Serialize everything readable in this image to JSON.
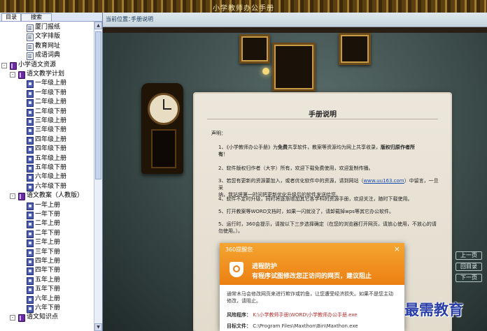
{
  "window": {
    "title": "小学教师办公手册"
  },
  "left_tabs": [
    {
      "label": "目录"
    },
    {
      "label": "搜索"
    }
  ],
  "tree": [
    {
      "label": "厦门报纸",
      "indent": 2,
      "icon": "document-icon",
      "expander": ""
    },
    {
      "label": "文字排版",
      "indent": 2,
      "icon": "document-icon",
      "expander": ""
    },
    {
      "label": "教育网址",
      "indent": 2,
      "icon": "document-icon",
      "expander": ""
    },
    {
      "label": "成语词典",
      "indent": 2,
      "icon": "document-icon",
      "expander": ""
    },
    {
      "label": "小学语文资源",
      "indent": 0,
      "icon": "book-icon",
      "expander": "-"
    },
    {
      "label": "语文教学计划",
      "indent": 1,
      "icon": "book-icon",
      "expander": "-"
    },
    {
      "label": "一年级上册",
      "indent": 2,
      "icon": "page-icon",
      "expander": ""
    },
    {
      "label": "一年级下册",
      "indent": 2,
      "icon": "page-icon",
      "expander": ""
    },
    {
      "label": "二年级上册",
      "indent": 2,
      "icon": "page-icon",
      "expander": ""
    },
    {
      "label": "二年级下册",
      "indent": 2,
      "icon": "page-icon",
      "expander": ""
    },
    {
      "label": "三年级上册",
      "indent": 2,
      "icon": "page-icon",
      "expander": ""
    },
    {
      "label": "三年级下册",
      "indent": 2,
      "icon": "page-icon",
      "expander": ""
    },
    {
      "label": "四年级上册",
      "indent": 2,
      "icon": "page-icon",
      "expander": ""
    },
    {
      "label": "四年级下册",
      "indent": 2,
      "icon": "page-icon",
      "expander": ""
    },
    {
      "label": "五年级上册",
      "indent": 2,
      "icon": "page-icon",
      "expander": ""
    },
    {
      "label": "五年级下册",
      "indent": 2,
      "icon": "page-icon",
      "expander": ""
    },
    {
      "label": "六年级上册",
      "indent": 2,
      "icon": "page-icon",
      "expander": ""
    },
    {
      "label": "六年级下册",
      "indent": 2,
      "icon": "page-icon",
      "expander": ""
    },
    {
      "label": "语文教案（人教版）",
      "indent": 1,
      "icon": "book-icon",
      "expander": "-"
    },
    {
      "label": "一年上册",
      "indent": 2,
      "icon": "page-icon",
      "expander": ""
    },
    {
      "label": "一年下册",
      "indent": 2,
      "icon": "page-icon",
      "expander": ""
    },
    {
      "label": "二年上册",
      "indent": 2,
      "icon": "page-icon",
      "expander": ""
    },
    {
      "label": "二年下册",
      "indent": 2,
      "icon": "page-icon",
      "expander": ""
    },
    {
      "label": "三年上册",
      "indent": 2,
      "icon": "page-icon",
      "expander": ""
    },
    {
      "label": "三年下册",
      "indent": 2,
      "icon": "page-icon",
      "expander": ""
    },
    {
      "label": "四年上册",
      "indent": 2,
      "icon": "page-icon",
      "expander": ""
    },
    {
      "label": "四年下册",
      "indent": 2,
      "icon": "page-icon",
      "expander": ""
    },
    {
      "label": "五年上册",
      "indent": 2,
      "icon": "page-icon",
      "expander": ""
    },
    {
      "label": "五年下册",
      "indent": 2,
      "icon": "page-icon",
      "expander": ""
    },
    {
      "label": "六年上册",
      "indent": 2,
      "icon": "page-icon",
      "expander": ""
    },
    {
      "label": "六年下册",
      "indent": 2,
      "icon": "page-icon",
      "expander": ""
    },
    {
      "label": "语文知识点",
      "indent": 1,
      "icon": "book-icon",
      "expander": "-"
    }
  ],
  "breadcrumb": {
    "prefix": "当前位置：",
    "current": "手册说明"
  },
  "document": {
    "title": "手册说明",
    "intro": "声明：",
    "p1_a": "1、《小学教师办公手册》为",
    "p1_bold1": "免费",
    "p1_b": "共享软件，教案等资源均为网上共享收录，",
    "p1_bold2": "版权归原作者所",
    "p1_bold3": "有",
    "p1_c": "！",
    "p2": "2、软件版权归作者（大宇）所有，欢迎下载免费使用，欢迎复制传播。",
    "p3_a": "3、若您有更新的资源要加入，或者优化软件中的资源，请到网站（",
    "p3_link": "www.uu163.com",
    "p3_b": "）中留言，一旦采",
    "p3_c": "纳，我站将第一时间把更新优化升级后的软件发送给您。",
    "p4": "4、软件不定时升级，同时将逐渐增加其它各学科的资源手册，欢迎关注，随时下载使用。",
    "p5": "5、打开教案等WORD文档时，如果一闪就没了，请卸载掉wps等其它办公软件。",
    "p6_a": "5、运行时，360会提示，请按以下三步选择确定（在您的浏览器打开网页，请放心使用，不放心的请",
    "p6_b": "勿使用。）。"
  },
  "nav_buttons": {
    "prev": "上一页",
    "home": "回目录",
    "next": "下一页"
  },
  "popup": {
    "brand": "360提醒您",
    "close": "×",
    "heading1": "进程防护",
    "heading2": "有程序试图修改您正访问的网页，建议阻止",
    "desc": "通常木马会修改网页来进行欺诈或钓鱼，让您遭受经济损失。如果不是您主动修改，请阻止。",
    "risk_label": "风险程序：",
    "risk_path": "K:\\小学教师手册\\WORD\\小学教师办公手册.exe",
    "target_label": "目标文件：",
    "target_path": "C:\\Program Files\\Maxthon\\Bin\\Maxthon.exe"
  },
  "watermark": "最需教育"
}
